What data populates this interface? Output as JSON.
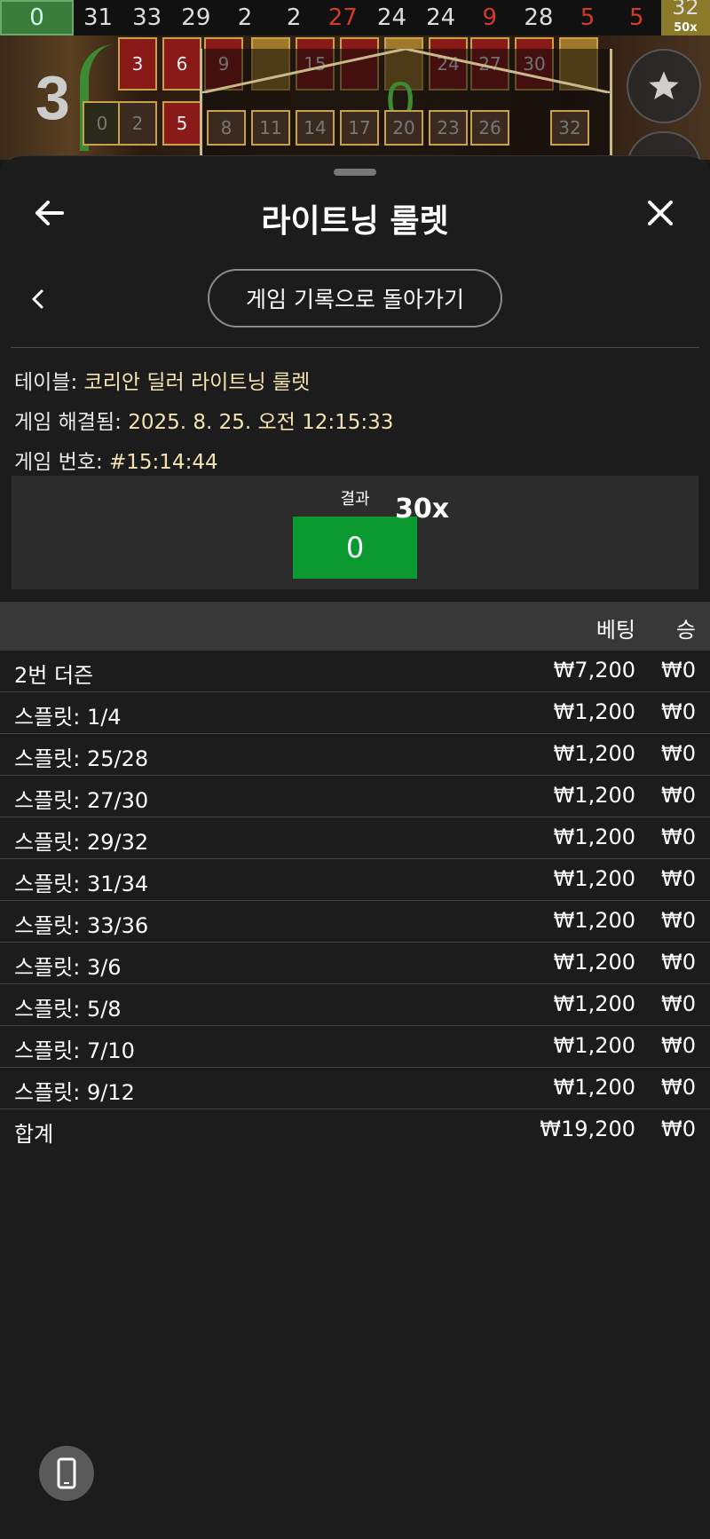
{
  "history": [
    {
      "n": "0",
      "color": "green"
    },
    {
      "n": "31",
      "color": "black"
    },
    {
      "n": "33",
      "color": "black"
    },
    {
      "n": "29",
      "color": "black"
    },
    {
      "n": "2",
      "color": "black"
    },
    {
      "n": "2",
      "color": "black"
    },
    {
      "n": "27",
      "color": "red"
    },
    {
      "n": "24",
      "color": "black"
    },
    {
      "n": "24",
      "color": "black"
    },
    {
      "n": "9",
      "color": "red"
    },
    {
      "n": "28",
      "color": "black"
    },
    {
      "n": "5",
      "color": "red"
    },
    {
      "n": "5",
      "color": "red"
    },
    {
      "n": "32",
      "color": "gold",
      "multiplier": "50x"
    }
  ],
  "background": {
    "big_number": "3",
    "zero_display": "0",
    "tiles": [
      "3",
      "6",
      "9",
      "15",
      "24",
      "27",
      "30",
      "0",
      "2",
      "5",
      "8",
      "11",
      "14",
      "17",
      "20",
      "23",
      "26",
      "32"
    ]
  },
  "sheet": {
    "title": "라이트닝 룰렛",
    "back_to_history": "게임 기록으로 돌아가기",
    "info": {
      "table_label": "테이블:",
      "table_value": "코리안 딜러 라이트닝 룰렛",
      "resolved_label": "게임 해결됨:",
      "resolved_value": "2025. 8. 25. 오전 12:15:33",
      "number_label": "게임 번호:",
      "number_value": "#15:14:44"
    },
    "result": {
      "label": "결과",
      "number": "0",
      "multiplier": "30x"
    },
    "table": {
      "col_bet": "베팅",
      "col_win": "승",
      "rows": [
        {
          "label": "2번 더즌",
          "bet": "₩7,200",
          "win": "₩0"
        },
        {
          "label": "스플릿: 1/4",
          "bet": "₩1,200",
          "win": "₩0"
        },
        {
          "label": "스플릿: 25/28",
          "bet": "₩1,200",
          "win": "₩0"
        },
        {
          "label": "스플릿: 27/30",
          "bet": "₩1,200",
          "win": "₩0"
        },
        {
          "label": "스플릿: 29/32",
          "bet": "₩1,200",
          "win": "₩0"
        },
        {
          "label": "스플릿: 31/34",
          "bet": "₩1,200",
          "win": "₩0"
        },
        {
          "label": "스플릿: 33/36",
          "bet": "₩1,200",
          "win": "₩0"
        },
        {
          "label": "스플릿: 3/6",
          "bet": "₩1,200",
          "win": "₩0"
        },
        {
          "label": "스플릿: 5/8",
          "bet": "₩1,200",
          "win": "₩0"
        },
        {
          "label": "스플릿: 7/10",
          "bet": "₩1,200",
          "win": "₩0"
        },
        {
          "label": "스플릿: 9/12",
          "bet": "₩1,200",
          "win": "₩0"
        }
      ],
      "total": {
        "label": "합계",
        "bet": "₩19,200",
        "win": "₩0"
      }
    }
  },
  "colors": {
    "result_green": "#0a9a2f",
    "info_value": "#f3e3b0",
    "history_red": "#d33a2a"
  },
  "icons": [
    "back-arrow-icon",
    "close-icon",
    "chevron-left-icon",
    "star-icon",
    "mobile-device-icon"
  ]
}
